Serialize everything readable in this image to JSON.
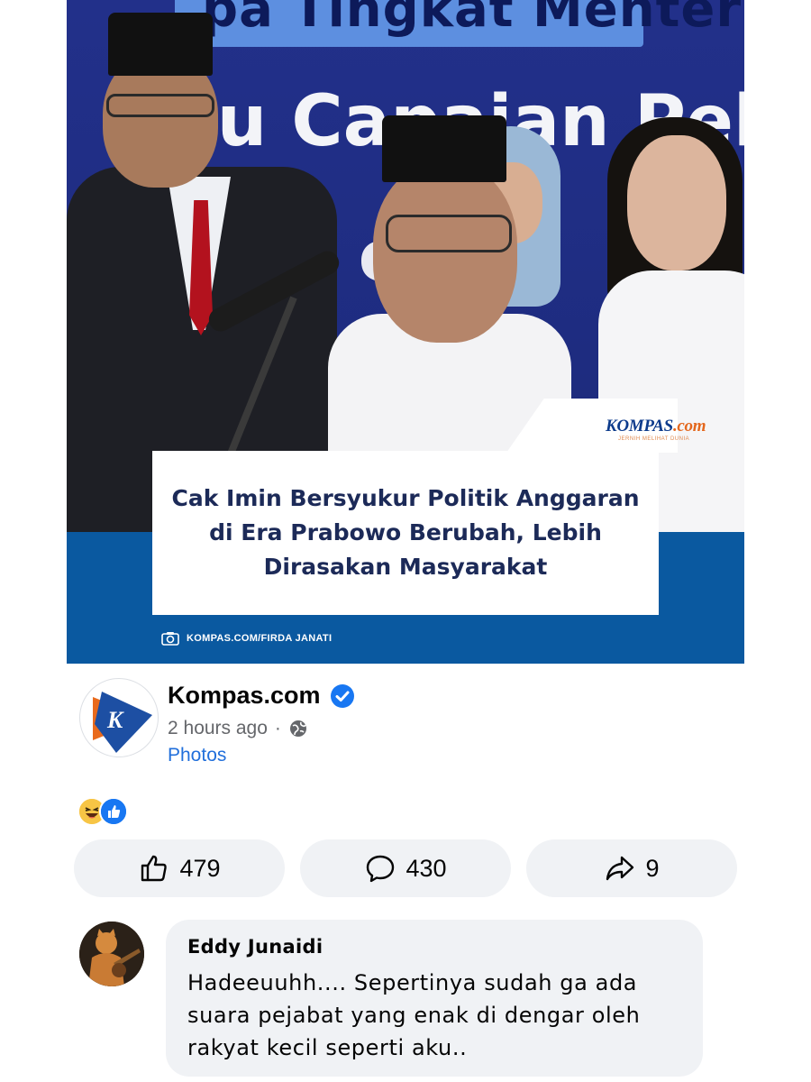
{
  "news_image": {
    "banner_top_text": "pa Tingkat Menteri",
    "backdrop_line1": "lu  Capaian Pelak",
    "backdrop_line2": "s   es",
    "publisher_logo": "KOMPAS",
    "publisher_logo_suffix": ".com",
    "publisher_tagline": "JERNIH MELIHAT DUNIA",
    "headline": "Cak Imin Bersyukur Politik Anggaran di Era Prabowo Berubah, Lebih Dirasakan Masyarakat",
    "photo_credit": "KOMPAS.COM/FIRDA JANATI",
    "colors": {
      "navy": "#1e2c80",
      "band": "#0a59a0",
      "headline_text": "#1c2a58"
    }
  },
  "post": {
    "page_name": "Kompas.com",
    "verified": true,
    "timestamp": "2 hours ago",
    "separator": "·",
    "audience_icon": "globe-icon",
    "post_type": "Photos"
  },
  "reactions": {
    "types": [
      "haha",
      "like"
    ]
  },
  "actions": {
    "like_count": "479",
    "comment_count": "430",
    "share_count": "9"
  },
  "comment": {
    "author": "Eddy Junaidi",
    "text": "Hadeeuuhh.... Sepertinya sudah ga ada suara pejabat yang enak di dengar oleh rakyat kecil seperti aku.."
  },
  "theme": {
    "accent": "#1877f2",
    "link": "#216fdb",
    "muted": "#65676b",
    "button_bg": "#f0f2f5"
  }
}
